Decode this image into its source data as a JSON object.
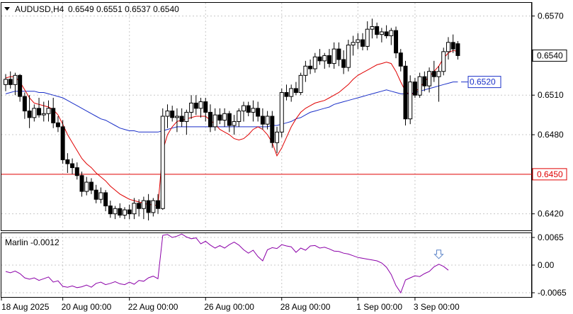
{
  "header": {
    "symbol": "AUDUSD,H4",
    "ohlc": "0.6549 0.6551 0.6537 0.6540"
  },
  "indicator": {
    "label": "Marlin -0.0012"
  },
  "colors": {
    "background": "#ffffff",
    "grid": "#c8c8c8",
    "candle": "#000000",
    "ma_fast": "#e00000",
    "ma_slow": "#1a2fc8",
    "level_line": "#e00000",
    "osc": "#8b00a8",
    "arrow": "#5b84c8"
  },
  "chart_data": [
    {
      "type": "candlestick",
      "title": "AUDUSD,H4",
      "ylim": [
        0.6408,
        0.658
      ],
      "y_ticks": [
        "0.6570",
        "0.6510",
        "0.6480",
        "0.6420"
      ],
      "price_badges": [
        {
          "label": "0.6540",
          "value": 0.654,
          "style": "current"
        },
        {
          "label": "0.6450",
          "value": 0.645,
          "style": "level"
        },
        {
          "label": "0.6520",
          "value": 0.652,
          "style": "annotation"
        }
      ],
      "x_labels": [
        "18 Aug 2025",
        "20 Aug 00:00",
        "22 Aug 00:00",
        "26 Aug 00:00",
        "28 Aug 00:00",
        "1 Sep 00:00",
        "3 Sep 00:00"
      ],
      "horizontal_level": 0.645,
      "candles": [
        [
          0.6518,
          0.6526,
          0.6513,
          0.6522
        ],
        [
          0.6522,
          0.6528,
          0.6515,
          0.6518
        ],
        [
          0.6518,
          0.6527,
          0.651,
          0.6525
        ],
        [
          0.6525,
          0.6526,
          0.6505,
          0.6509
        ],
        [
          0.6509,
          0.6512,
          0.6492,
          0.6498
        ],
        [
          0.6498,
          0.651,
          0.6485,
          0.6493
        ],
        [
          0.6493,
          0.6503,
          0.649,
          0.65
        ],
        [
          0.65,
          0.6508,
          0.6493,
          0.6495
        ],
        [
          0.6495,
          0.6505,
          0.649,
          0.6496
        ],
        [
          0.6496,
          0.6506,
          0.649,
          0.65
        ],
        [
          0.65,
          0.6508,
          0.6485,
          0.6489
        ],
        [
          0.6489,
          0.6494,
          0.6482,
          0.6486
        ],
        [
          0.6486,
          0.6491,
          0.6458,
          0.6461
        ],
        [
          0.6461,
          0.6466,
          0.6451,
          0.6458
        ],
        [
          0.6458,
          0.6462,
          0.645,
          0.6455
        ],
        [
          0.6455,
          0.6459,
          0.6446,
          0.6449
        ],
        [
          0.6449,
          0.6452,
          0.6433,
          0.6437
        ],
        [
          0.6437,
          0.6448,
          0.6434,
          0.6444
        ],
        [
          0.6444,
          0.6447,
          0.6435,
          0.6438
        ],
        [
          0.6438,
          0.6442,
          0.6428,
          0.6431
        ],
        [
          0.6431,
          0.644,
          0.6428,
          0.6436
        ],
        [
          0.6436,
          0.6438,
          0.6422,
          0.6426
        ],
        [
          0.6426,
          0.643,
          0.6417,
          0.642
        ],
        [
          0.642,
          0.6426,
          0.6416,
          0.6424
        ],
        [
          0.6424,
          0.6428,
          0.6417,
          0.6419
        ],
        [
          0.6419,
          0.6425,
          0.6416,
          0.6423
        ],
        [
          0.6423,
          0.6427,
          0.6416,
          0.642
        ],
        [
          0.642,
          0.6432,
          0.6416,
          0.6428
        ],
        [
          0.6428,
          0.6431,
          0.6418,
          0.6424
        ],
        [
          0.6424,
          0.6433,
          0.6416,
          0.643
        ],
        [
          0.643,
          0.6435,
          0.6415,
          0.6421
        ],
        [
          0.6421,
          0.6432,
          0.6418,
          0.643
        ],
        [
          0.643,
          0.6435,
          0.642,
          0.6424
        ],
        [
          0.6424,
          0.65,
          0.6423,
          0.6494
        ],
        [
          0.6494,
          0.6503,
          0.6485,
          0.6498
        ],
        [
          0.6498,
          0.6502,
          0.649,
          0.6493
        ],
        [
          0.6493,
          0.65,
          0.6482,
          0.6494
        ],
        [
          0.6494,
          0.65,
          0.6486,
          0.649
        ],
        [
          0.649,
          0.6499,
          0.648,
          0.6497
        ],
        [
          0.6497,
          0.651,
          0.6492,
          0.6504
        ],
        [
          0.6504,
          0.651,
          0.6495,
          0.65
        ],
        [
          0.65,
          0.6508,
          0.6493,
          0.6505
        ],
        [
          0.6505,
          0.6508,
          0.649,
          0.6497
        ],
        [
          0.6497,
          0.6503,
          0.6482,
          0.6486
        ],
        [
          0.6486,
          0.65,
          0.6483,
          0.6495
        ],
        [
          0.6495,
          0.65,
          0.6488,
          0.6491
        ],
        [
          0.6491,
          0.65,
          0.6486,
          0.6496
        ],
        [
          0.6496,
          0.6498,
          0.6482,
          0.6487
        ],
        [
          0.6487,
          0.6495,
          0.648,
          0.649
        ],
        [
          0.649,
          0.65,
          0.6486,
          0.6498
        ],
        [
          0.6498,
          0.6505,
          0.649,
          0.6502
        ],
        [
          0.6502,
          0.6505,
          0.6494,
          0.6497
        ],
        [
          0.6497,
          0.6506,
          0.649,
          0.65
        ],
        [
          0.65,
          0.6505,
          0.649,
          0.6494
        ],
        [
          0.6494,
          0.65,
          0.6484,
          0.6488
        ],
        [
          0.6488,
          0.6498,
          0.6484,
          0.6494
        ],
        [
          0.6494,
          0.6498,
          0.647,
          0.6474
        ],
        [
          0.6474,
          0.6486,
          0.6466,
          0.6482
        ],
        [
          0.6482,
          0.6515,
          0.6478,
          0.6512
        ],
        [
          0.6512,
          0.6518,
          0.6506,
          0.6509
        ],
        [
          0.6509,
          0.6518,
          0.6505,
          0.6515
        ],
        [
          0.6515,
          0.652,
          0.651,
          0.6512
        ],
        [
          0.6512,
          0.6527,
          0.651,
          0.6525
        ],
        [
          0.6525,
          0.6536,
          0.652,
          0.6532
        ],
        [
          0.6532,
          0.6537,
          0.6526,
          0.653
        ],
        [
          0.653,
          0.6542,
          0.6527,
          0.6539
        ],
        [
          0.6539,
          0.6545,
          0.6533,
          0.6536
        ],
        [
          0.6536,
          0.6542,
          0.653,
          0.654
        ],
        [
          0.654,
          0.6545,
          0.6531,
          0.6534
        ],
        [
          0.6534,
          0.655,
          0.653,
          0.6545
        ],
        [
          0.6545,
          0.655,
          0.6532,
          0.6537
        ],
        [
          0.6537,
          0.6544,
          0.6526,
          0.6531
        ],
        [
          0.6531,
          0.6552,
          0.6528,
          0.6548
        ],
        [
          0.6548,
          0.6555,
          0.654,
          0.655
        ],
        [
          0.655,
          0.6557,
          0.6545,
          0.6552
        ],
        [
          0.6552,
          0.6557,
          0.6544,
          0.6547
        ],
        [
          0.6547,
          0.6566,
          0.6544,
          0.656
        ],
        [
          0.656,
          0.6568,
          0.6553,
          0.6562
        ],
        [
          0.6562,
          0.6565,
          0.6553,
          0.6556
        ],
        [
          0.6556,
          0.6561,
          0.655,
          0.6558
        ],
        [
          0.6558,
          0.6563,
          0.6553,
          0.6555
        ],
        [
          0.6555,
          0.6561,
          0.6548,
          0.6559
        ],
        [
          0.6559,
          0.6562,
          0.6538,
          0.6542
        ],
        [
          0.6542,
          0.6545,
          0.6528,
          0.6532
        ],
        [
          0.6532,
          0.6536,
          0.6487,
          0.6492
        ],
        [
          0.6492,
          0.6525,
          0.6488,
          0.652
        ],
        [
          0.652,
          0.6523,
          0.6508,
          0.651
        ],
        [
          0.651,
          0.6527,
          0.6508,
          0.6524
        ],
        [
          0.6524,
          0.6528,
          0.6513,
          0.6517
        ],
        [
          0.6517,
          0.6531,
          0.6512,
          0.6528
        ],
        [
          0.6528,
          0.6536,
          0.652,
          0.6524
        ],
        [
          0.6524,
          0.6532,
          0.6505,
          0.6528
        ],
        [
          0.6528,
          0.6546,
          0.6525,
          0.6543
        ],
        [
          0.6543,
          0.6554,
          0.6537,
          0.655
        ],
        [
          0.655,
          0.6556,
          0.6542,
          0.6545
        ],
        [
          0.6549,
          0.6551,
          0.6537,
          0.654
        ]
      ],
      "ma_fast": [
        0.6523,
        0.6524,
        0.6524,
        0.652,
        0.6514,
        0.6508,
        0.6504,
        0.6503,
        0.6502,
        0.6501,
        0.6499,
        0.6495,
        0.6488,
        0.648,
        0.6474,
        0.6468,
        0.6462,
        0.6458,
        0.6455,
        0.6451,
        0.6448,
        0.6445,
        0.6441,
        0.6438,
        0.6435,
        0.6433,
        0.6431,
        0.643,
        0.6429,
        0.6428,
        0.6427,
        0.6427,
        0.6426,
        0.6468,
        0.648,
        0.6486,
        0.649,
        0.6491,
        0.6492,
        0.6493,
        0.6494,
        0.6494,
        0.6494,
        0.6491,
        0.6488,
        0.6484,
        0.6482,
        0.648,
        0.6477,
        0.6476,
        0.6477,
        0.648,
        0.6484,
        0.6486,
        0.6484,
        0.648,
        0.6474,
        0.6464,
        0.647,
        0.6478,
        0.6486,
        0.6492,
        0.6497,
        0.65,
        0.6502,
        0.6504,
        0.6505,
        0.6506,
        0.6508,
        0.651,
        0.6512,
        0.6515,
        0.6518,
        0.6522,
        0.6525,
        0.6527,
        0.6529,
        0.6531,
        0.6533,
        0.6534,
        0.6535,
        0.6534,
        0.6528,
        0.652,
        0.6513,
        0.651,
        0.6512,
        0.6516,
        0.652,
        0.6524,
        0.6528,
        0.6532,
        0.6538,
        0.6542,
        0.6544,
        0.6543
      ],
      "ma_slow": [
        0.6511,
        0.6512,
        0.6513,
        0.6513,
        0.6513,
        0.6513,
        0.6513,
        0.6512,
        0.6512,
        0.6511,
        0.651,
        0.6509,
        0.6508,
        0.6506,
        0.6504,
        0.6502,
        0.65,
        0.6498,
        0.6496,
        0.6494,
        0.6492,
        0.6491,
        0.6489,
        0.6487,
        0.6485,
        0.6484,
        0.6483,
        0.6483,
        0.6482,
        0.6482,
        0.6482,
        0.6482,
        0.6482,
        0.6483,
        0.6484,
        0.6485,
        0.6486,
        0.6486,
        0.6486,
        0.6486,
        0.6486,
        0.6486,
        0.6486,
        0.6486,
        0.6486,
        0.6486,
        0.6486,
        0.6486,
        0.6486,
        0.6486,
        0.6486,
        0.6486,
        0.6486,
        0.6486,
        0.6486,
        0.6486,
        0.6487,
        0.6487,
        0.6488,
        0.6489,
        0.649,
        0.6492,
        0.6493,
        0.6495,
        0.6497,
        0.6498,
        0.6499,
        0.65,
        0.6501,
        0.6503,
        0.6504,
        0.6505,
        0.6506,
        0.6507,
        0.6508,
        0.6509,
        0.651,
        0.6511,
        0.6512,
        0.6513,
        0.6514,
        0.6513,
        0.6512,
        0.6511,
        0.6511,
        0.6511,
        0.6512,
        0.6513,
        0.6514,
        0.6515,
        0.6516,
        0.6517,
        0.6518,
        0.6519,
        0.652,
        0.652
      ]
    },
    {
      "type": "line",
      "title": "Marlin -0.0012",
      "ylim": [
        -0.0075,
        0.0075
      ],
      "y_ticks": [
        "0.0065",
        "0.00",
        "-0.0065"
      ],
      "series": [
        {
          "name": "Marlin",
          "values": [
            -0.0015,
            -0.0018,
            -0.0014,
            -0.002,
            -0.003,
            -0.0033,
            -0.003,
            -0.0036,
            -0.0032,
            -0.0028,
            -0.004,
            -0.0037,
            -0.005,
            -0.0052,
            -0.0049,
            -0.0053,
            -0.0051,
            -0.0047,
            -0.0052,
            -0.0043,
            -0.004,
            -0.0046,
            -0.0043,
            -0.0039,
            -0.0044,
            -0.0046,
            -0.004,
            -0.0045,
            -0.0036,
            -0.0038,
            -0.003,
            -0.0026,
            -0.0032,
            0.007,
            0.0072,
            0.0065,
            0.0068,
            0.0073,
            0.0066,
            0.0062,
            0.0064,
            0.005,
            0.0056,
            0.0047,
            0.004,
            0.0046,
            0.004,
            0.0048,
            0.0054,
            0.0047,
            0.0036,
            0.0028,
            0.0035,
            0.002,
            0.001,
            0.0036,
            0.0041,
            0.0039,
            0.0048,
            0.0045,
            0.0043,
            0.003,
            0.004,
            0.0035,
            0.0045,
            0.0046,
            0.004,
            0.0042,
            0.0038,
            0.0033,
            0.0032,
            0.0028,
            0.0026,
            0.0022,
            0.0018,
            0.0016,
            0.0014,
            0.0012,
            0.001,
            0.0005,
            -0.0005,
            -0.0022,
            -0.0048,
            -0.0065,
            -0.0035,
            -0.003,
            -0.0025,
            -0.0027,
            -0.002,
            -0.0015,
            -0.0004,
            0.0002,
            -0.0003,
            -0.0012
          ]
        }
      ],
      "annotations": [
        {
          "type": "down-arrow",
          "index": 91
        }
      ]
    }
  ]
}
